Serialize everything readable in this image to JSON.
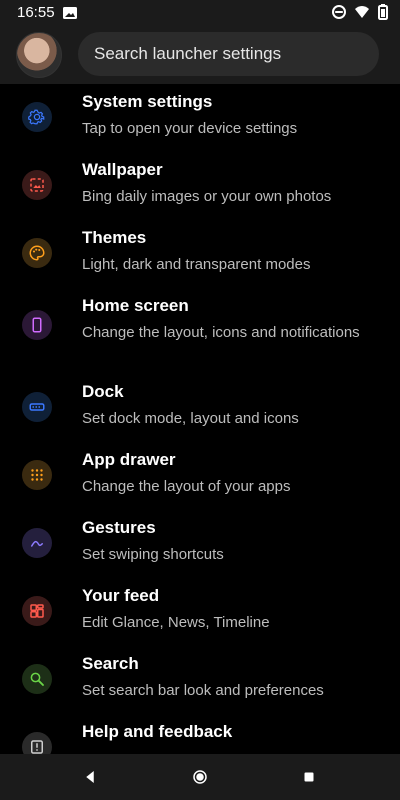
{
  "status_bar": {
    "time": "16:55"
  },
  "header": {
    "search_placeholder": "Search launcher settings"
  },
  "items": [
    {
      "title": "System settings",
      "subtitle": "Tap to open your device settings",
      "icon": "gear-icon",
      "color": "#3b78ff",
      "bg": "#0f2037"
    },
    {
      "title": "Wallpaper",
      "subtitle": "Bing daily images or your own photos",
      "icon": "wallpaper-icon",
      "color": "#ff5a4d",
      "bg": "#3a1a19"
    },
    {
      "title": "Themes",
      "subtitle": "Light, dark and transparent modes",
      "icon": "palette-icon",
      "color": "#ff9f1c",
      "bg": "#3a2a10"
    },
    {
      "title": "Home screen",
      "subtitle": "Change the layout, icons and notifications",
      "icon": "phone-icon",
      "color": "#d16bff",
      "bg": "#2b1836"
    },
    {
      "title": "Dock",
      "subtitle": "Set dock mode, layout and icons",
      "icon": "dock-icon",
      "color": "#3b78ff",
      "bg": "#0f2037"
    },
    {
      "title": "App drawer",
      "subtitle": "Change the layout of your apps",
      "icon": "app-grid-icon",
      "color": "#ff9f1c",
      "bg": "#3a2a10"
    },
    {
      "title": "Gestures",
      "subtitle": "Set swiping shortcuts",
      "icon": "gesture-icon",
      "color": "#8d7bff",
      "bg": "#241f3d"
    },
    {
      "title": "Your feed",
      "subtitle": "Edit Glance, News, Timeline",
      "icon": "feed-icon",
      "color": "#ff5a4d",
      "bg": "#3a1a19"
    },
    {
      "title": "Search",
      "subtitle": "Set search bar look and preferences",
      "icon": "search-icon",
      "color": "#6ad447",
      "bg": "#1d2f17"
    },
    {
      "title": "Help and feedback",
      "subtitle": "",
      "icon": "help-icon",
      "color": "#cfcfcf",
      "bg": "#2a2a2a"
    }
  ]
}
